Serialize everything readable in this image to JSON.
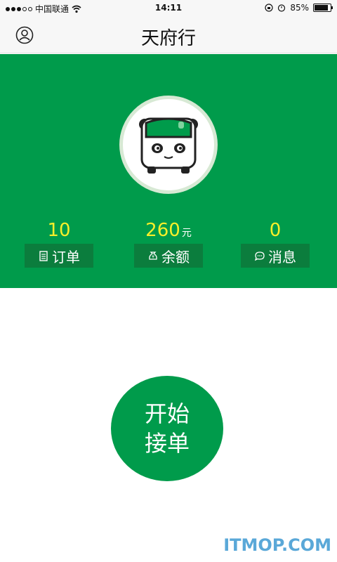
{
  "status_bar": {
    "carrier": "中国联通",
    "time": "14:11",
    "battery_percent": "85%"
  },
  "header": {
    "title": "天府行"
  },
  "stats": [
    {
      "value": "10",
      "unit": "",
      "label": "订单",
      "icon": "clipboard-icon"
    },
    {
      "value": "260",
      "unit": "元",
      "label": "余额",
      "icon": "money-bag-icon"
    },
    {
      "value": "0",
      "unit": "",
      "label": "消息",
      "icon": "chat-bubble-icon"
    }
  ],
  "start_button": {
    "line1": "开始",
    "line2": "接单"
  },
  "watermark": "ITMOP.COM",
  "colors": {
    "brand_green": "#009b4b",
    "dark_green": "#0b7d3d",
    "value_yellow": "#f7ef2a"
  }
}
